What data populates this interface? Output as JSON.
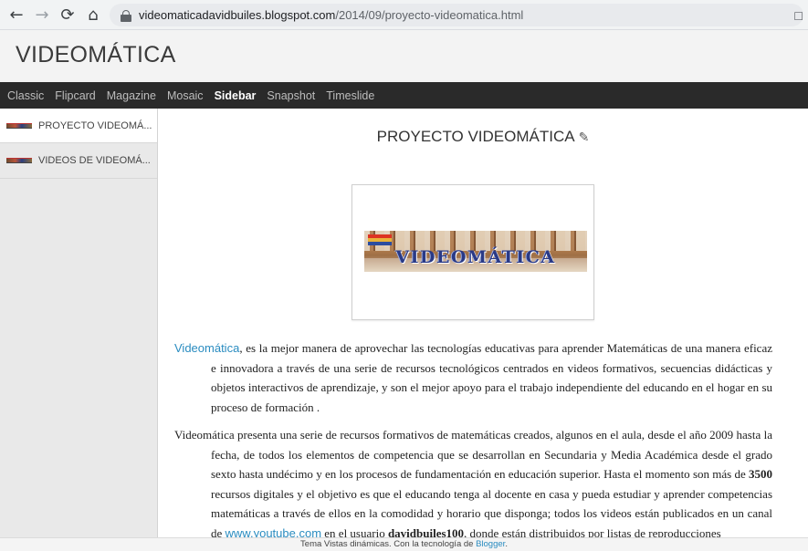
{
  "browser": {
    "url_host": "videomaticadavidbuiles.blogspot.com",
    "url_path": "/2014/09/proyecto-videomatica.html"
  },
  "blog": {
    "title": "VIDEOMÁTICA"
  },
  "views": [
    {
      "label": "Classic"
    },
    {
      "label": "Flipcard"
    },
    {
      "label": "Magazine"
    },
    {
      "label": "Mosaic"
    },
    {
      "label": "Sidebar",
      "active": true
    },
    {
      "label": "Snapshot"
    },
    {
      "label": "Timeslide"
    }
  ],
  "sidebar": {
    "items": [
      {
        "label": "PROYECTO VIDEOMÁ..."
      },
      {
        "label": "VIDEOS DE VIDEOMÁ..."
      }
    ]
  },
  "post": {
    "title": "PROYECTO VIDEOMÁTICA",
    "image_text": "VIDEOMÁTICA",
    "p1_link": "Videomática",
    "p1_text": ", es la mejor manera de aprovechar las tecnologías educativas para aprender Matemáticas de una manera eficaz e innovadora a través de una serie de recursos tecnológicos centrados en videos formativos, secuencias didácticas y objetos interactivos de aprendizaje, y son el mejor apoyo para el trabajo independiente del educando en el hogar en su proceso de formación .",
    "p2_a": "Videomática presenta una serie de recursos formativos de matemáticas creados, algunos en el aula, desde el año 2009 hasta la fecha, de todos los elementos de competencia que se desarrollan en Secundaria y Media Académica desde el grado sexto hasta undécimo y en los procesos de fundamentación en educación superior. Hasta el momento son más de ",
    "p2_bold": "3500",
    "p2_b": " recursos digitales y el objetivo es que el educando tenga al docente en casa y pueda estudiar y aprender competencias matemáticas a través de ellos en la comodidad y horario que disponga; todos los videos están publicados en un canal de ",
    "p2_link": "www.youtube.com",
    "p2_c": " en el usuario ",
    "p2_bold2": "davidbuiles100",
    "p2_d": ", donde están distribuidos por listas de reproducciones"
  },
  "footer": {
    "text": "Tema Vistas dinámicas. Con la tecnología de ",
    "link": "Blogger",
    "end": "."
  },
  "colors": {
    "link": "#2a8cc0",
    "viewbar": "#2a2a2a"
  },
  "icons": [
    "back-arrow-icon",
    "forward-arrow-icon",
    "reload-icon",
    "home-icon",
    "lock-icon",
    "pencil-icon"
  ]
}
